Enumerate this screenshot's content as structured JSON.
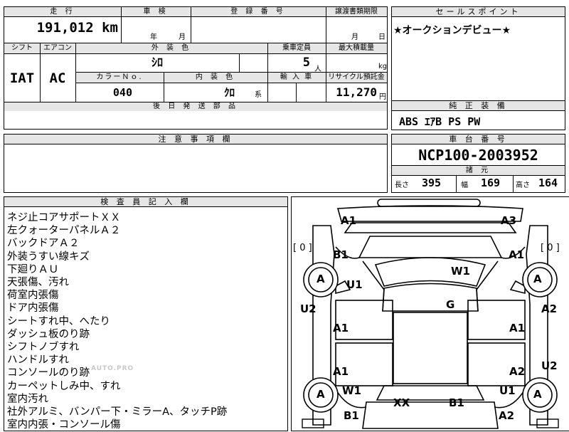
{
  "mileage": {
    "label": "走 行",
    "value": "191,012",
    "unit": "km"
  },
  "inspection": {
    "label": "車 検",
    "year_unit": "年",
    "month_unit": "月"
  },
  "registration": {
    "label": "登 録 番 号",
    "value": ""
  },
  "transfer_deadline": {
    "label": "譲渡書類期限",
    "month_unit": "月",
    "day_unit": "日"
  },
  "sales_point": {
    "label": "セールスポイント",
    "text": "★オークションデビュー★"
  },
  "shift": {
    "label": "シフト",
    "value": "IAT"
  },
  "aircon": {
    "label": "エアコン",
    "value": "AC"
  },
  "exterior_color": {
    "label": "外 装 色",
    "value": "ｼﾛ"
  },
  "capacity": {
    "label": "乗車定員",
    "value": "5",
    "unit": "人"
  },
  "max_load": {
    "label": "最大積載量",
    "unit": "kg"
  },
  "color_no": {
    "label": "カラーＮｏ.",
    "value": "040"
  },
  "interior_color": {
    "label": "内 装 色",
    "value": "ｸﾛ",
    "suffix": "系"
  },
  "import_car": {
    "label": "輸 入 車"
  },
  "recycle_fee": {
    "label": "リサイクル預託金",
    "value": "11,270",
    "unit": "円"
  },
  "later_parts": {
    "label": "後 日 発 送 部 品"
  },
  "genuine_equipment": {
    "label": "純 正 装 備",
    "value": "ABS ｴｱB PS PW"
  },
  "notes": {
    "label": "注 意 事 項 欄"
  },
  "chassis": {
    "label": "車 台 番 号",
    "value": "NCP100-2003952"
  },
  "dimensions": {
    "label": "諸 元",
    "length_label": "長さ",
    "length": "395",
    "width_label": "幅",
    "width": "169",
    "height_label": "高さ",
    "height": "164"
  },
  "inspector": {
    "label": "検 査 員 記 入 欄",
    "lines": [
      "ネジ止コアサポートＸＸ",
      "左クォーターパネルＡ２",
      "バックドアＡ２",
      "外装うすい線キズ",
      "下廻りＡＵ",
      "天張傷、汚れ",
      "荷室内張傷",
      "ドア内張傷",
      "シートすれ中、へたり",
      "ダッシュ板のり跡",
      "シフトノブすれ",
      "ハンドルすれ",
      "コンソールのり跡",
      "カーペットしみ中、すれ",
      "室内汚れ",
      "社外アルミ、バンパー下・ミラーA、タッチP跡",
      "室内内張・コンソール傷"
    ]
  },
  "diagram": {
    "tire_left": "[ 0 ]",
    "tire_right": "[ 0 ]",
    "marks": {
      "front_left_corner": "A1",
      "front_right_corner": "A3",
      "left_front_fender": "B1",
      "right_front_fender": "A1",
      "left_front_wheel": "A",
      "right_front_wheel": "A",
      "left_front_under": "U1",
      "windshield": "W1",
      "left_side_top": "U2",
      "right_side_top": "A2",
      "roof": "G",
      "left_front_door": "A1",
      "right_front_door": "A1",
      "left_rear_door": "A1",
      "right_rear_door": "A2",
      "right_side_bottom": "U2",
      "left_rear_wheel": "A",
      "right_rear_wheel": "A",
      "rear_window": "W1",
      "right_rear_under": "U1",
      "left_rear_fender": "B1",
      "right_rear_fender": "A2",
      "core_support": "XX",
      "back_door": "B1"
    }
  },
  "watermark": "AUTO.PRO"
}
